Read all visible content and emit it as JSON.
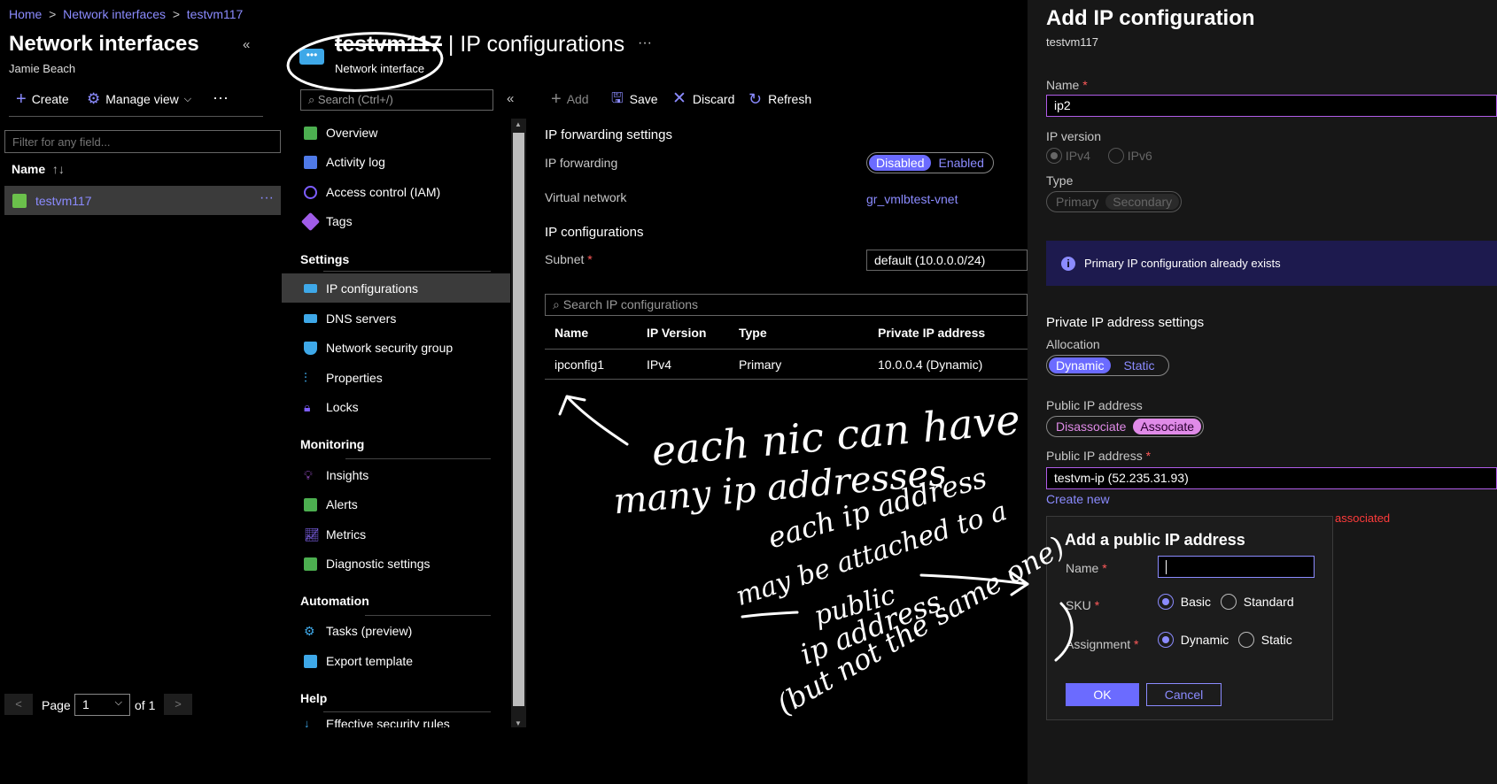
{
  "breadcrumb": {
    "items": [
      "Home",
      "Network interfaces",
      "testvm117"
    ]
  },
  "left": {
    "title": "Network interfaces",
    "subtitle": "Jamie Beach",
    "create_label": "Create",
    "manage_view_label": "Manage view",
    "filter_placeholder": "Filter for any field...",
    "name_header": "Name",
    "row_name": "testvm117",
    "page_label": "Page",
    "page_value": "1",
    "of_label": "of 1"
  },
  "resource": {
    "title_strike": "testvm117",
    "title_rest": " | IP configurations",
    "type_label": "Network interface",
    "search_placeholder": "Search (Ctrl+/)"
  },
  "menu": {
    "items_top": [
      "Overview",
      "Activity log",
      "Access control (IAM)",
      "Tags"
    ],
    "settings_header": "Settings",
    "settings_items": [
      "IP configurations",
      "DNS servers",
      "Network security group",
      "Properties",
      "Locks"
    ],
    "monitoring_header": "Monitoring",
    "monitoring_items": [
      "Insights",
      "Alerts",
      "Metrics",
      "Diagnostic settings"
    ],
    "automation_header": "Automation",
    "automation_items": [
      "Tasks (preview)",
      "Export template"
    ],
    "help_header": "Help",
    "help_items": [
      "Effective security rules"
    ]
  },
  "toolbar": {
    "add": "Add",
    "save": "Save",
    "discard": "Discard",
    "refresh": "Refresh"
  },
  "content": {
    "fwd_header": "IP forwarding settings",
    "ip_forwarding_label": "IP forwarding",
    "disabled": "Disabled",
    "enabled": "Enabled",
    "vnet_label": "Virtual network",
    "vnet_value": "gr_vmlbtest-vnet",
    "ipconf_header": "IP configurations",
    "subnet_label": "Subnet",
    "subnet_value": "default (10.0.0.0/24)",
    "search_placeholder": "Search IP configurations",
    "columns": [
      "Name",
      "IP Version",
      "Type",
      "Private IP address"
    ],
    "row": [
      "ipconfig1",
      "IPv4",
      "Primary",
      "10.0.0.4 (Dynamic)"
    ]
  },
  "panel": {
    "title": "Add IP configuration",
    "subtitle": "testvm117",
    "name_label": "Name",
    "name_value": "ip2",
    "ip_version_label": "IP version",
    "ipv4": "IPv4",
    "ipv6": "IPv6",
    "type_label": "Type",
    "primary": "Primary",
    "secondary": "Secondary",
    "info": "Primary IP configuration already exists",
    "private_header": "Private IP address settings",
    "allocation_label": "Allocation",
    "dynamic": "Dynamic",
    "static": "Static",
    "public_label": "Public IP address",
    "disassociate": "Disassociate",
    "associate": "Associate",
    "public_label2": "Public IP address",
    "public_value": "testvm-ip (52.235.31.93)",
    "create_new": "Create new",
    "error_tail": "associated"
  },
  "dialog": {
    "title": "Add a public IP address",
    "name_label": "Name",
    "sku_label": "SKU",
    "basic": "Basic",
    "standard": "Standard",
    "assignment_label": "Assignment",
    "dynamic": "Dynamic",
    "static": "Static",
    "ok": "OK",
    "cancel": "Cancel"
  },
  "annotations": {
    "note1_line1": "each nic can have",
    "note1_line2": "many ip addresses",
    "note2_line1": "each ip address",
    "note2_line2": "may be attached to a",
    "note2_line3": "public",
    "note2_line4": "ip address",
    "note2_line5": "(but not the same one)"
  }
}
